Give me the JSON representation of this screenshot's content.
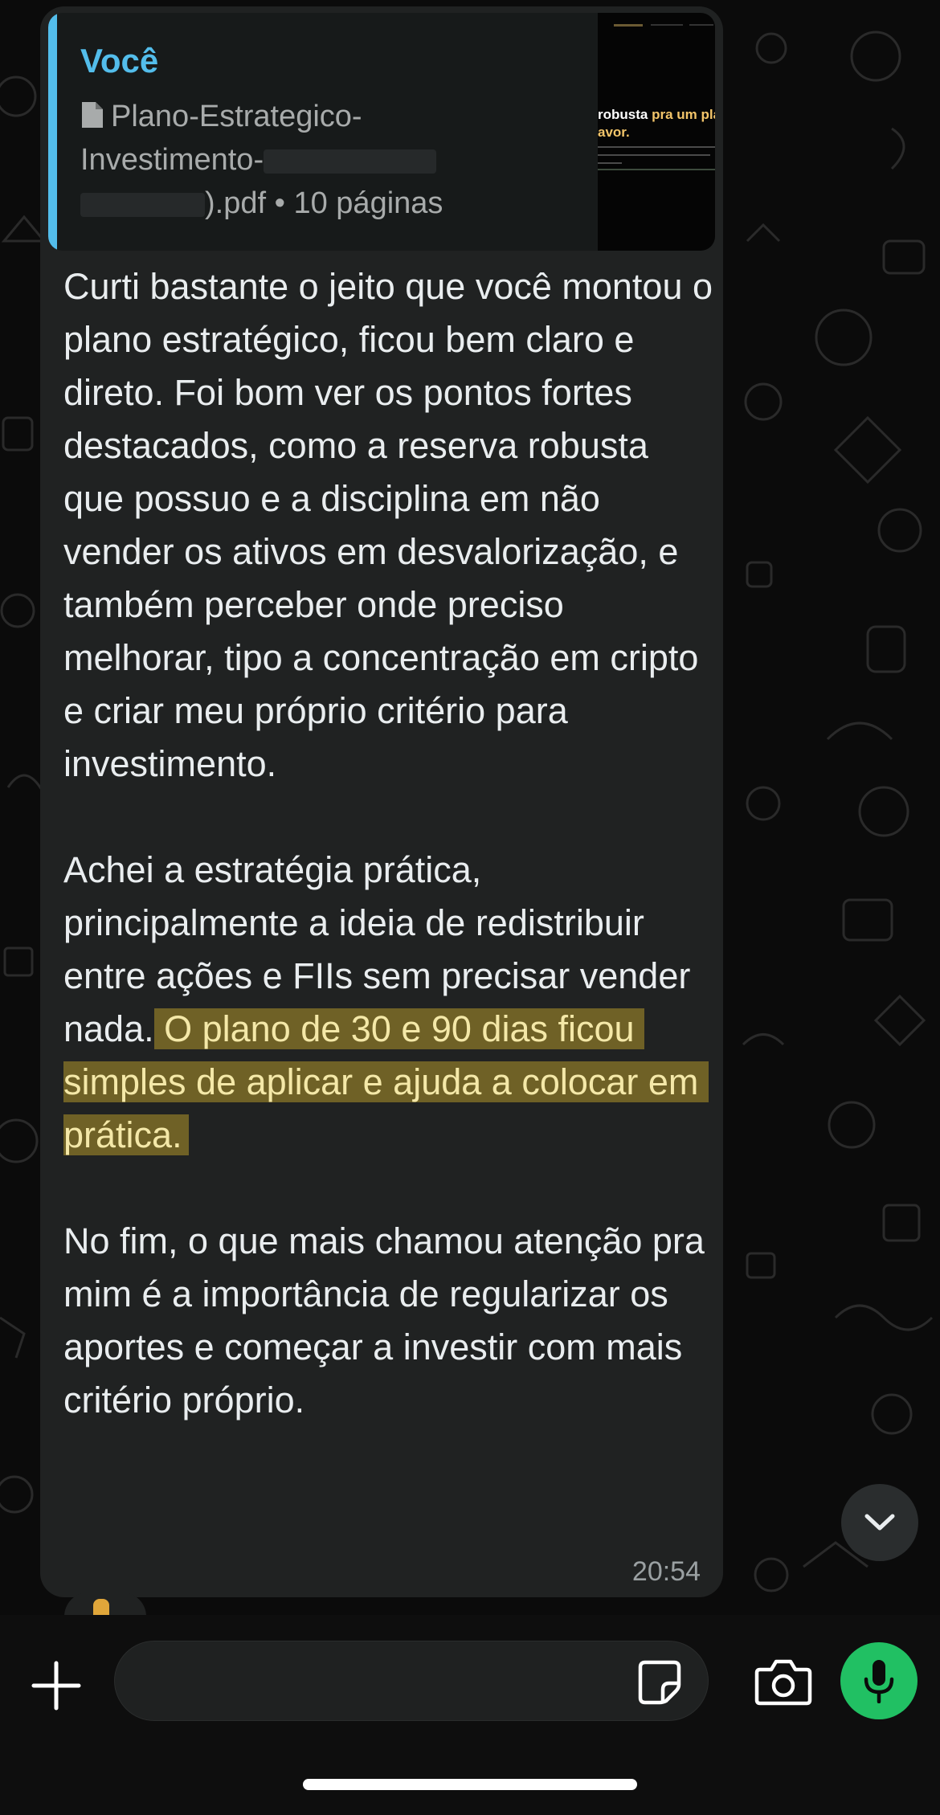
{
  "theme": {
    "accent_author": "#53bdeb",
    "highlight_bg": "#6f6126",
    "mic_button": "#21c063",
    "bubble_bg": "#202222"
  },
  "quoted_message": {
    "author": "Você",
    "doc_icon": "document-icon",
    "filename_line1": "Plano-Estrategico-",
    "filename_line2": "Investimento-",
    "filename_line3_suffix": ").pdf",
    "pages": "• 10 páginas",
    "thumbnail_heading_a": "robusta",
    "thumbnail_heading_b": " pra um plano",
    "thumbnail_heading_c": "avor."
  },
  "message": {
    "paragraph1": "Curti bastante o jeito que você montou o plano estratégico, ficou bem claro e direto. Foi bom ver os pontos fortes destacados, como a reserva robusta que possuo e a disciplina em não vender os ativos em desvalorização, e também perceber onde preciso melhorar, tipo a concentração em cripto e criar meu próprio critério para investimento.",
    "paragraph2_plain": "Achei a estratégia prática, principalmente a ideia de redistribuir entre ações e FIIs sem precisar vender nada. ",
    "paragraph2_highlight": "O plano de 30 e 90 dias ficou simples de aplicar e ajuda a colocar em prática.",
    "paragraph3": "No fim, o que mais chamou atenção pra mim é a importância de regularizar os aportes e começar a investir com mais critério próprio.",
    "time": "20:54"
  },
  "controls": {
    "scroll_down_icon": "chevron-down-icon",
    "attach_icon": "plus-icon",
    "sticker_icon": "sticker-icon",
    "camera_icon": "camera-icon",
    "mic_icon": "microphone-icon",
    "input_placeholder": ""
  }
}
